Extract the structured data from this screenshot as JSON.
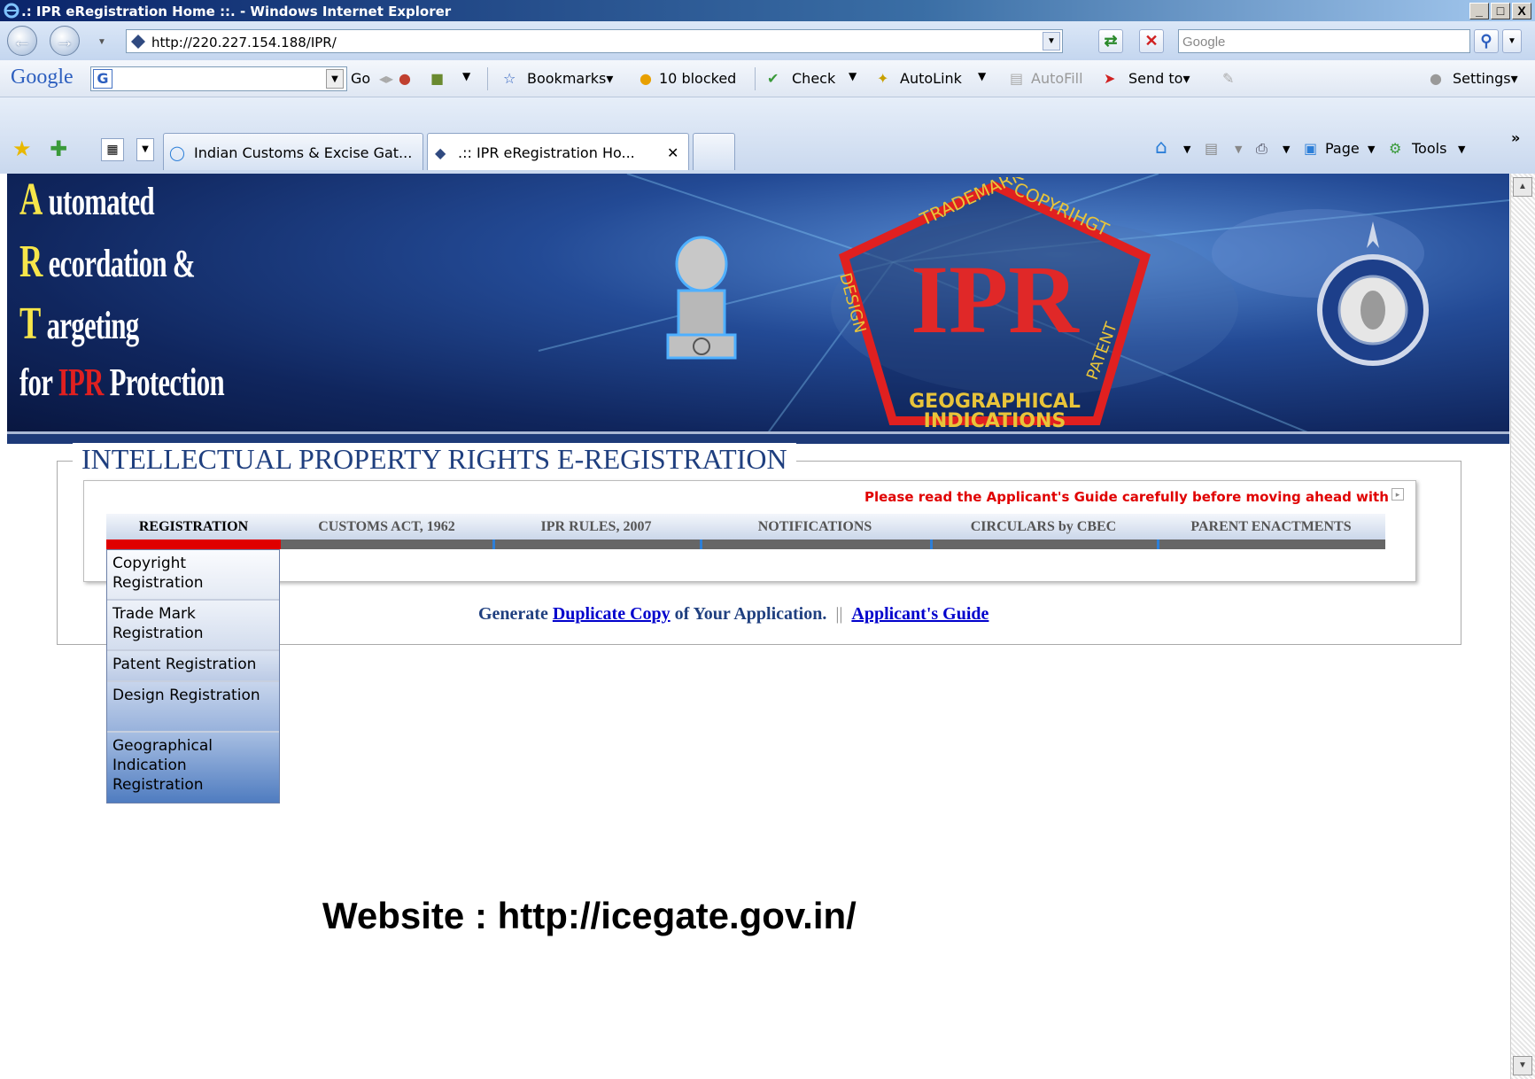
{
  "window": {
    "title": ".: IPR eRegistration Home ::. - Windows Internet Explorer",
    "min_glyph": "_",
    "max_glyph": "□",
    "close_glyph": "X"
  },
  "address_bar": {
    "url": "http://220.227.154.188/IPR/",
    "search_placeholder": "Google"
  },
  "google_toolbar": {
    "logo": "Google",
    "go_label": "Go",
    "bookmarks_label": "Bookmarks▾",
    "blocked_label": "10 blocked",
    "check_label": "Check",
    "autolink_label": "AutoLink",
    "autofill_label": "AutoFill",
    "sendto_label": "Send to▾",
    "settings_label": "Settings▾"
  },
  "tabs": [
    {
      "label": "Indian Customs & Excise Gat..."
    },
    {
      "label": ".:: IPR eRegistration Ho..."
    }
  ],
  "command_bar": {
    "page_label": "Page",
    "tools_label": "Tools",
    "overflow": "»"
  },
  "banner": {
    "lines": [
      {
        "cap": "A",
        "rest": " utomated"
      },
      {
        "cap": "R",
        "rest": " ecordation &"
      },
      {
        "cap": "T",
        "rest": " argeting"
      }
    ],
    "last_line_pre": "for ",
    "last_line_ipr": "IPR",
    "last_line_post": " Protection",
    "pentagon_center": "IPR",
    "pentagon_top": "TRADEMARK",
    "pentagon_right_top": "COPYRIHGT",
    "pentagon_left": "DESIGN",
    "pentagon_right": "PATENT",
    "pentagon_bottom1": "GEOGRAPHICAL",
    "pentagon_bottom2": "INDICATIONS"
  },
  "section": {
    "legend": "INTELLECTUAL PROPERTY RIGHTS E-REGISTRATION",
    "notice": "Please read the Applicant's Guide carefully before moving ahead with"
  },
  "menu": [
    {
      "label": "REGISTRATION"
    },
    {
      "label": "CUSTOMS ACT, 1962"
    },
    {
      "label": "IPR RULES, 2007"
    },
    {
      "label": "NOTIFICATIONS"
    },
    {
      "label": "CIRCULARS by CBEC"
    },
    {
      "label": "PARENT ENACTMENTS"
    }
  ],
  "dropdown": [
    {
      "label": "Copyright Registration"
    },
    {
      "label": "Trade Mark Registration"
    },
    {
      "label": "Patent Registration"
    },
    {
      "label": "Design Registration"
    },
    {
      "label": "Geographical Indication Registration"
    }
  ],
  "links_line": {
    "prefix": "Generate ",
    "duplicate_link": "Duplicate Copy",
    "suffix": " of Your Application.",
    "pipe": "||",
    "guide_link": "Applicant's Guide"
  },
  "website_text": "Website : http://icegate.gov.in/",
  "colors": {
    "menu_active": "#e00000",
    "notice": "#e00000",
    "legend": "#1f3f7f",
    "title_bar": "#0a246a"
  }
}
